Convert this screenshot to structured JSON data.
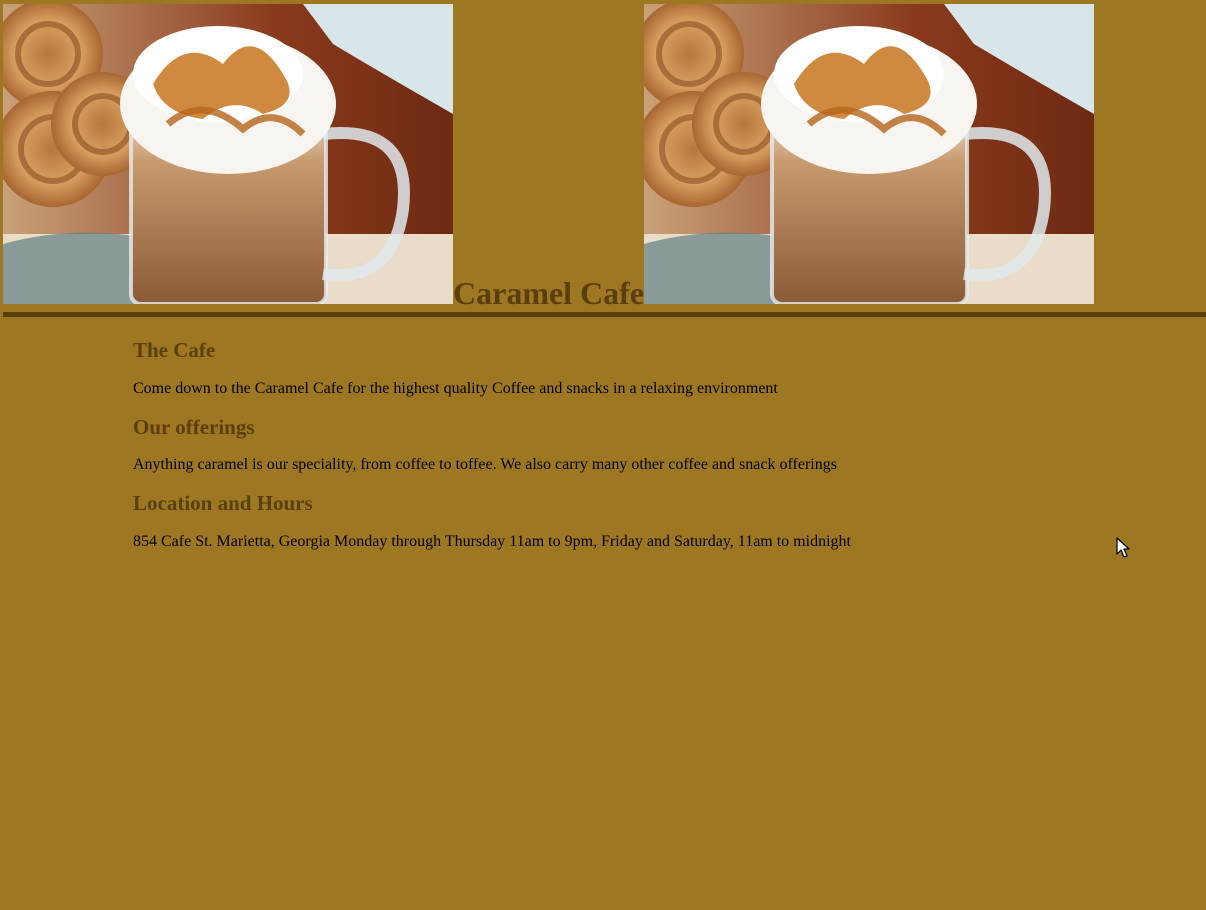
{
  "header": {
    "title": "Caramel Cafe",
    "left_image": "caramel-latte-photo",
    "right_image": "caramel-latte-photo"
  },
  "sections": [
    {
      "heading": "The Cafe",
      "text": "Come down to the Caramel Cafe for the highest quality Coffee and snacks in a relaxing environment"
    },
    {
      "heading": "Our offerings",
      "text": "Anything caramel is our speciality, from coffee to toffee. We also carry many other coffee and snack offerings"
    },
    {
      "heading": "Location and Hours",
      "text": "854 Cafe St. Marietta, Georgia Monday through Thursday 11am to 9pm, Friday and Saturday, 11am to midnight"
    }
  ],
  "colors": {
    "background": "#9e7722",
    "heading": "#5a3f0a",
    "rule": "#5a3f0a",
    "body_text": "#000000"
  }
}
